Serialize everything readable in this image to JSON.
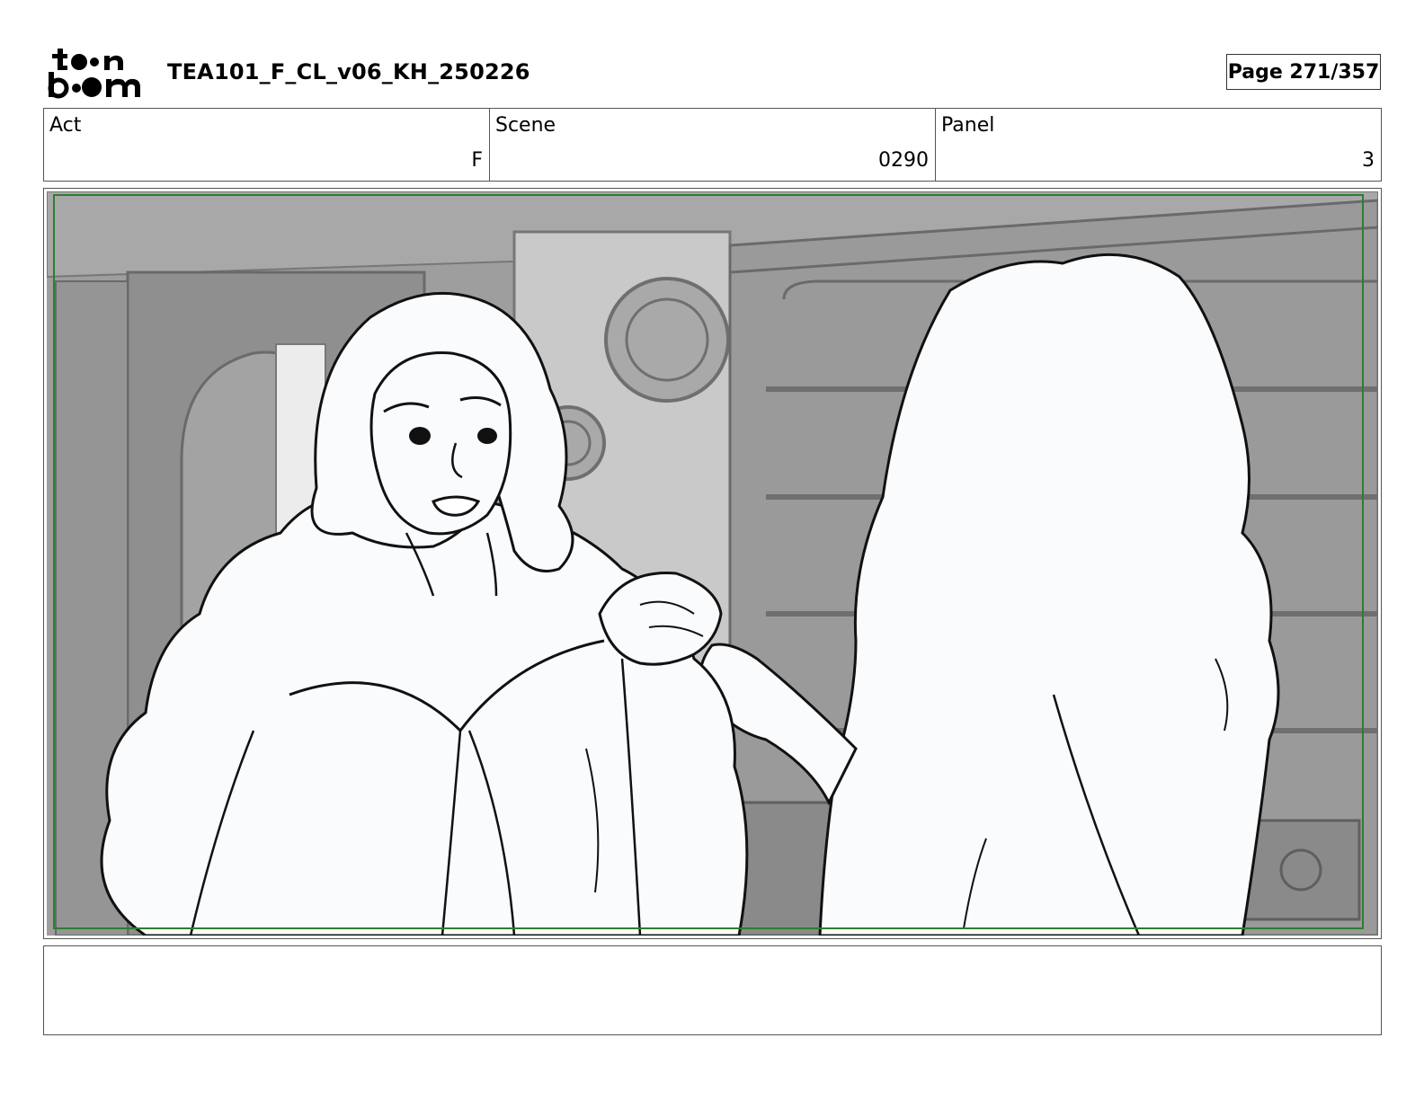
{
  "header": {
    "logo_alt": "toon boom",
    "document_title": "TEA101_F_CL_v06_KH_250226",
    "page_indicator": "Page 271/357"
  },
  "info": {
    "act_label": "Act",
    "act_value": "F",
    "scene_label": "Scene",
    "scene_value": "0290",
    "panel_label": "Panel",
    "panel_value": "3"
  },
  "panel": {
    "safe_frame_color": "#2e7d32",
    "background_tone": "#9e9e9e",
    "line_color": "#111111",
    "character_fill": "#fafbfd"
  },
  "notes": {
    "text": ""
  }
}
